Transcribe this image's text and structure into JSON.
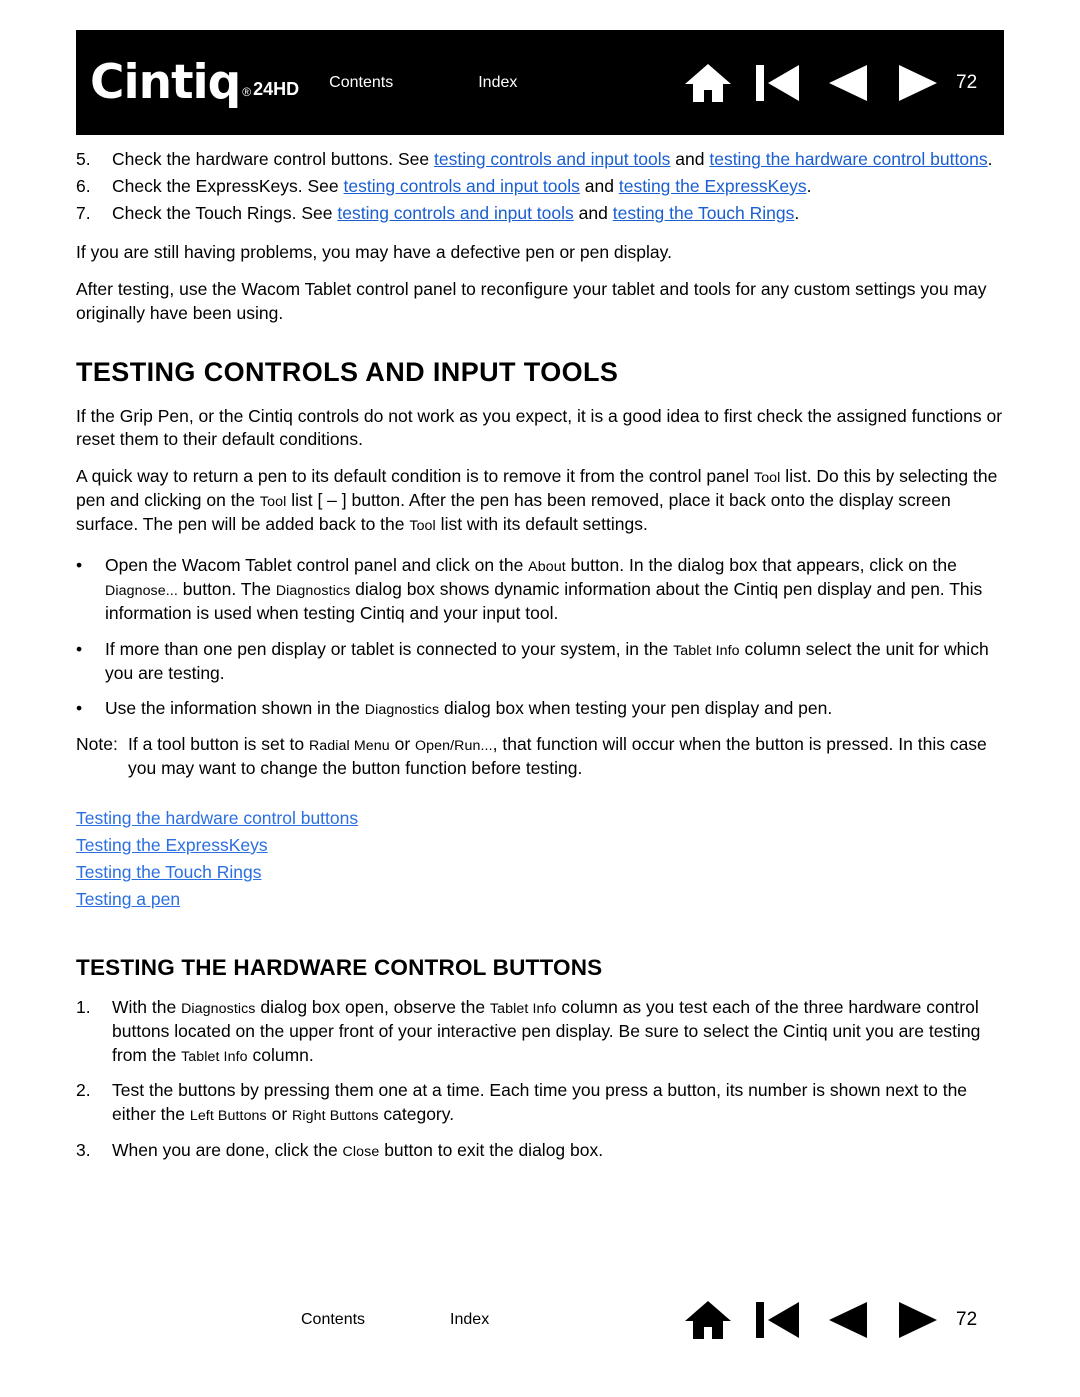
{
  "header": {
    "brand": "Cintiq",
    "brand_reg": "®",
    "model": "24HD",
    "contents_label": "Contents",
    "index_label": "Index",
    "page_number": "72",
    "icons": [
      "home-icon",
      "first-page-icon",
      "previous-page-icon",
      "next-page-icon"
    ]
  },
  "footer": {
    "contents_label": "Contents",
    "index_label": "Index",
    "page_number": "72",
    "icons": [
      "home-icon",
      "first-page-icon",
      "previous-page-icon",
      "next-page-icon"
    ]
  },
  "body": {
    "step5": {
      "num": "5.",
      "t1": "Check the hardware control buttons.  See ",
      "l1": "testing controls and input tools",
      "t2": " and ",
      "l2": "testing the hardware control buttons",
      "t3": "."
    },
    "step6": {
      "num": "6.",
      "t1": "Check the ExpressKeys.  See ",
      "l1": "testing controls and input tools",
      "t2": " and ",
      "l2": "testing the ExpressKeys",
      "t3": "."
    },
    "step7": {
      "num": "7.",
      "t1": "Check the Touch Rings.  See ",
      "l1": "testing controls and input tools",
      "t2": " and ",
      "l2": "testing the Touch Rings",
      "t3": "."
    },
    "para_defective": "If you are still having problems, you may have a defective pen or pen display.",
    "para_after_testing": "After testing, use the Wacom Tablet control panel to reconfigure your tablet and tools for any custom settings you may originally have been using.",
    "section_title": "TESTING CONTROLS AND INPUT TOOLS",
    "para_grip_pen": "If the Grip Pen, or the Cintiq controls do not work as you expect, it is a good idea to first check the assigned functions or reset them to their default conditions.",
    "para_quick_way": {
      "t1": "A quick way to return a pen to its default condition is to remove it from the control panel ",
      "sc1": "Tool",
      "t2": " list.  Do this by selecting the pen and clicking on the ",
      "sc2": "Tool",
      "t3": " list [ – ] button.  After the pen has been removed, place it back onto the display screen surface.  The pen will be added back to the ",
      "sc3": "Tool",
      "t4": " list with its default settings."
    },
    "bullet1": {
      "t1": "Open the Wacom Tablet control panel and click on the ",
      "sc1": "About",
      "t2": " button.  In the dialog box that appears, click on the ",
      "sc2": "Diagnose...",
      "t3": " button.  The ",
      "sc3": "Diagnostics",
      "t4": " dialog box shows dynamic information about the Cintiq pen display and pen.  This information is used when testing Cintiq and your input tool."
    },
    "bullet2": {
      "t1": "If more than one pen display or tablet is connected to your system, in the ",
      "sc1": "Tablet Info",
      "t2": " column select the unit for which you are testing."
    },
    "bullet3": {
      "t1": "Use the information shown in the ",
      "sc1": "Diagnostics",
      "t2": " dialog box when testing your pen display and pen."
    },
    "note": {
      "label": "Note:",
      "t1": "If a tool button is set to ",
      "sc1": "Radial Menu",
      "t2": " or ",
      "sc2": "Open/Run...",
      "t3": ", that function will occur when the button is pressed.  In this case you may want to change the button function before testing."
    },
    "toc_links": [
      "Testing the hardware control buttons",
      "Testing the ExpressKeys",
      "Testing the Touch Rings",
      "Testing a pen"
    ],
    "subsection_title": "TESTING THE HARDWARE CONTROL BUTTONS",
    "sub_step1": {
      "num": "1.",
      "t1": "With the ",
      "sc1": "Diagnostics",
      "t2": " dialog box open, observe the ",
      "sc2": "Tablet Info",
      "t3": " column as you test each of the three hardware control buttons located on the upper front of your interactive pen display.  Be sure to select the Cintiq unit you are testing from the ",
      "sc3": "Tablet Info",
      "t4": " column."
    },
    "sub_step2": {
      "num": "2.",
      "t1": "Test the buttons by pressing them one at a time.  Each time you press a button, its number is shown next to the either the ",
      "sc1": "Left Buttons",
      "t2": " or ",
      "sc2": "Right Buttons",
      "t3": " category."
    },
    "sub_step3": {
      "num": "3.",
      "t1": "When you are done, click the ",
      "sc1": "Close",
      "t2": " button to exit the dialog box."
    }
  },
  "colors": {
    "header_bg": "#000000",
    "link": "#1a5fd0",
    "toc_link": "#2b6fe0",
    "nav_icon_header": "#ffffff",
    "nav_icon_footer": "#000000"
  }
}
